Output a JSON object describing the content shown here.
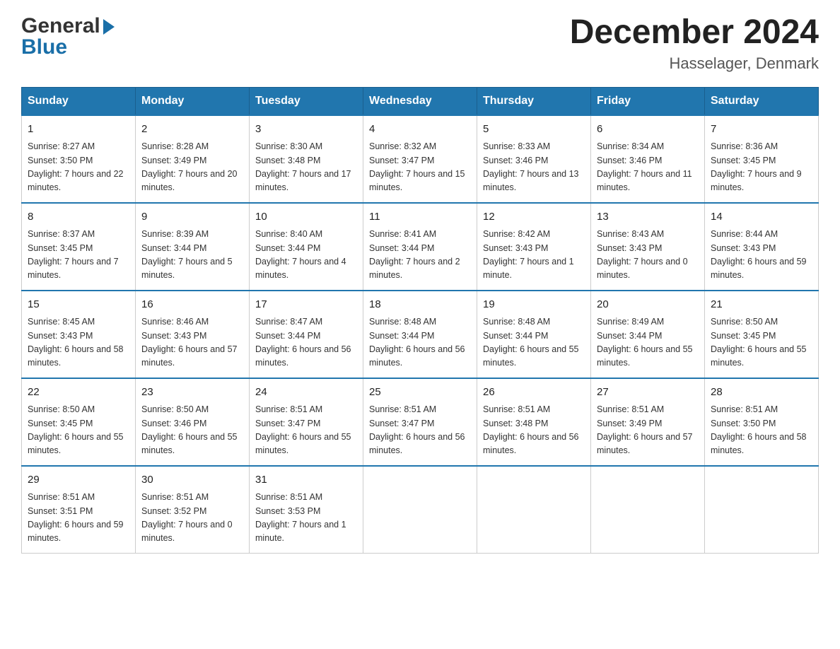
{
  "header": {
    "logo_general": "General",
    "logo_blue": "Blue",
    "month_title": "December 2024",
    "location": "Hasselager, Denmark"
  },
  "weekdays": [
    "Sunday",
    "Monday",
    "Tuesday",
    "Wednesday",
    "Thursday",
    "Friday",
    "Saturday"
  ],
  "weeks": [
    [
      {
        "day": "1",
        "sunrise": "8:27 AM",
        "sunset": "3:50 PM",
        "daylight": "7 hours and 22 minutes."
      },
      {
        "day": "2",
        "sunrise": "8:28 AM",
        "sunset": "3:49 PM",
        "daylight": "7 hours and 20 minutes."
      },
      {
        "day": "3",
        "sunrise": "8:30 AM",
        "sunset": "3:48 PM",
        "daylight": "7 hours and 17 minutes."
      },
      {
        "day": "4",
        "sunrise": "8:32 AM",
        "sunset": "3:47 PM",
        "daylight": "7 hours and 15 minutes."
      },
      {
        "day": "5",
        "sunrise": "8:33 AM",
        "sunset": "3:46 PM",
        "daylight": "7 hours and 13 minutes."
      },
      {
        "day": "6",
        "sunrise": "8:34 AM",
        "sunset": "3:46 PM",
        "daylight": "7 hours and 11 minutes."
      },
      {
        "day": "7",
        "sunrise": "8:36 AM",
        "sunset": "3:45 PM",
        "daylight": "7 hours and 9 minutes."
      }
    ],
    [
      {
        "day": "8",
        "sunrise": "8:37 AM",
        "sunset": "3:45 PM",
        "daylight": "7 hours and 7 minutes."
      },
      {
        "day": "9",
        "sunrise": "8:39 AM",
        "sunset": "3:44 PM",
        "daylight": "7 hours and 5 minutes."
      },
      {
        "day": "10",
        "sunrise": "8:40 AM",
        "sunset": "3:44 PM",
        "daylight": "7 hours and 4 minutes."
      },
      {
        "day": "11",
        "sunrise": "8:41 AM",
        "sunset": "3:44 PM",
        "daylight": "7 hours and 2 minutes."
      },
      {
        "day": "12",
        "sunrise": "8:42 AM",
        "sunset": "3:43 PM",
        "daylight": "7 hours and 1 minute."
      },
      {
        "day": "13",
        "sunrise": "8:43 AM",
        "sunset": "3:43 PM",
        "daylight": "7 hours and 0 minutes."
      },
      {
        "day": "14",
        "sunrise": "8:44 AM",
        "sunset": "3:43 PM",
        "daylight": "6 hours and 59 minutes."
      }
    ],
    [
      {
        "day": "15",
        "sunrise": "8:45 AM",
        "sunset": "3:43 PM",
        "daylight": "6 hours and 58 minutes."
      },
      {
        "day": "16",
        "sunrise": "8:46 AM",
        "sunset": "3:43 PM",
        "daylight": "6 hours and 57 minutes."
      },
      {
        "day": "17",
        "sunrise": "8:47 AM",
        "sunset": "3:44 PM",
        "daylight": "6 hours and 56 minutes."
      },
      {
        "day": "18",
        "sunrise": "8:48 AM",
        "sunset": "3:44 PM",
        "daylight": "6 hours and 56 minutes."
      },
      {
        "day": "19",
        "sunrise": "8:48 AM",
        "sunset": "3:44 PM",
        "daylight": "6 hours and 55 minutes."
      },
      {
        "day": "20",
        "sunrise": "8:49 AM",
        "sunset": "3:44 PM",
        "daylight": "6 hours and 55 minutes."
      },
      {
        "day": "21",
        "sunrise": "8:50 AM",
        "sunset": "3:45 PM",
        "daylight": "6 hours and 55 minutes."
      }
    ],
    [
      {
        "day": "22",
        "sunrise": "8:50 AM",
        "sunset": "3:45 PM",
        "daylight": "6 hours and 55 minutes."
      },
      {
        "day": "23",
        "sunrise": "8:50 AM",
        "sunset": "3:46 PM",
        "daylight": "6 hours and 55 minutes."
      },
      {
        "day": "24",
        "sunrise": "8:51 AM",
        "sunset": "3:47 PM",
        "daylight": "6 hours and 55 minutes."
      },
      {
        "day": "25",
        "sunrise": "8:51 AM",
        "sunset": "3:47 PM",
        "daylight": "6 hours and 56 minutes."
      },
      {
        "day": "26",
        "sunrise": "8:51 AM",
        "sunset": "3:48 PM",
        "daylight": "6 hours and 56 minutes."
      },
      {
        "day": "27",
        "sunrise": "8:51 AM",
        "sunset": "3:49 PM",
        "daylight": "6 hours and 57 minutes."
      },
      {
        "day": "28",
        "sunrise": "8:51 AM",
        "sunset": "3:50 PM",
        "daylight": "6 hours and 58 minutes."
      }
    ],
    [
      {
        "day": "29",
        "sunrise": "8:51 AM",
        "sunset": "3:51 PM",
        "daylight": "6 hours and 59 minutes."
      },
      {
        "day": "30",
        "sunrise": "8:51 AM",
        "sunset": "3:52 PM",
        "daylight": "7 hours and 0 minutes."
      },
      {
        "day": "31",
        "sunrise": "8:51 AM",
        "sunset": "3:53 PM",
        "daylight": "7 hours and 1 minute."
      },
      null,
      null,
      null,
      null
    ]
  ],
  "labels": {
    "sunrise": "Sunrise:",
    "sunset": "Sunset:",
    "daylight": "Daylight:"
  }
}
